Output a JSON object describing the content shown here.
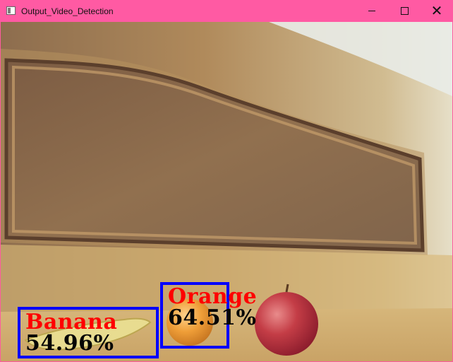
{
  "window": {
    "title": "Output_Video_Detection",
    "controls": {
      "minimize": "minimize",
      "maximize": "maximize",
      "close": "✕"
    }
  },
  "detections": [
    {
      "label": "Banana",
      "confidence": "54.96%"
    },
    {
      "label": "Orange",
      "confidence": "64.51%"
    }
  ],
  "colors": {
    "titlebar": "#ff5aa3",
    "box": "#0000ff",
    "label": "#ff0000",
    "confidence": "#050505"
  },
  "icons": [
    "window-app-icon",
    "minimize-icon",
    "maximize-icon",
    "close-icon"
  ]
}
